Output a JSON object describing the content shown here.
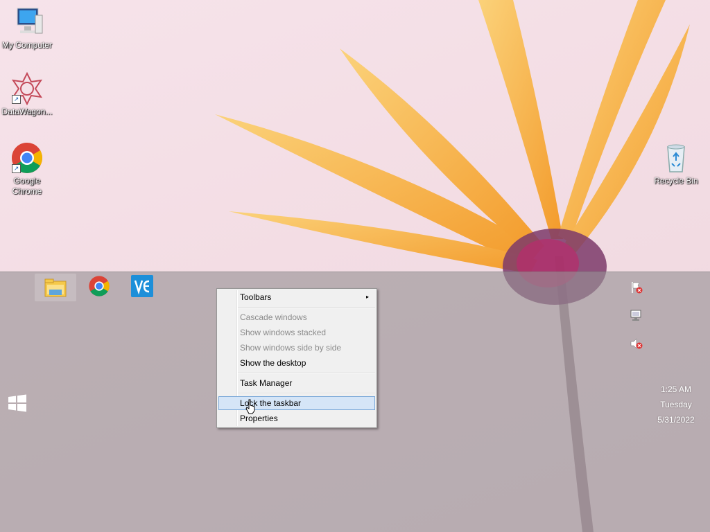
{
  "desktop": {
    "icons": [
      {
        "label": "My Computer",
        "icon": "computer-icon"
      },
      {
        "label": "DataWagon...",
        "icon": "datawagon-icon"
      },
      {
        "label": "Google Chrome",
        "icon": "chrome-icon"
      },
      {
        "label": "Recycle Bin",
        "icon": "recycle-bin-icon"
      }
    ]
  },
  "taskbar": {
    "pinned": [
      {
        "icon": "file-explorer-icon"
      },
      {
        "icon": "chrome-icon"
      },
      {
        "icon": "vnc-viewer-icon"
      }
    ],
    "start_icon": "windows-logo-icon",
    "tray": [
      {
        "icon": "action-center-error-icon"
      },
      {
        "icon": "network-icon"
      },
      {
        "icon": "volume-muted-icon"
      }
    ],
    "clock": {
      "time": "1:25 AM",
      "day": "Tuesday",
      "date": "5/31/2022"
    }
  },
  "context_menu": {
    "items": [
      {
        "label": "Toolbars",
        "enabled": true,
        "has_submenu": true
      },
      {
        "label": "Cascade windows",
        "enabled": false
      },
      {
        "label": "Show windows stacked",
        "enabled": false
      },
      {
        "label": "Show windows side by side",
        "enabled": false
      },
      {
        "label": "Show the desktop",
        "enabled": true
      },
      {
        "label": "Task Manager",
        "enabled": true
      },
      {
        "label": "Lock the taskbar",
        "enabled": true,
        "highlighted": true
      },
      {
        "label": "Properties",
        "enabled": true
      }
    ],
    "submenu_arrow": "▸"
  },
  "colors": {
    "menu_highlight": "#d5e5f7",
    "menu_highlight_border": "#7aa8d8",
    "petal": "#f7a935"
  }
}
